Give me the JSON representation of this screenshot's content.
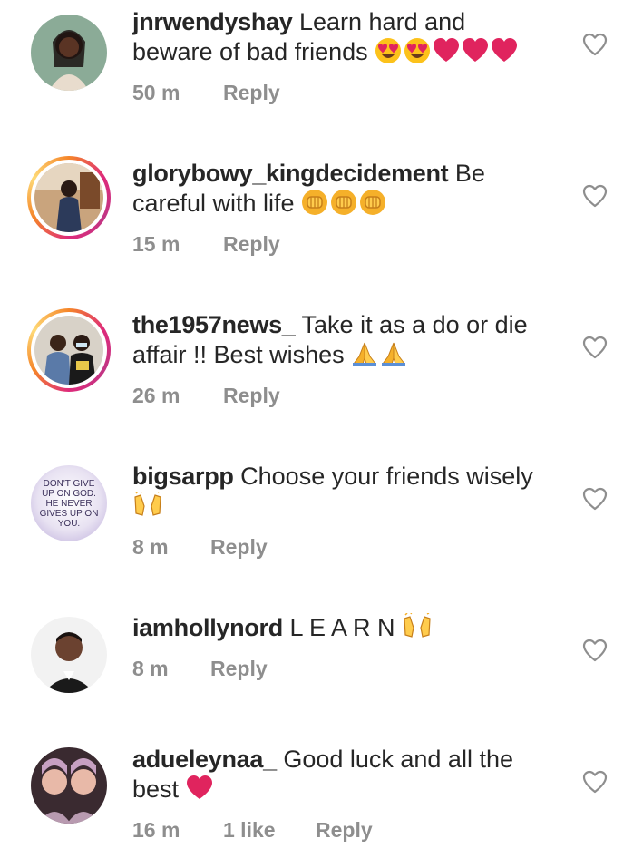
{
  "comments": [
    {
      "username": "jnrwendyshay",
      "text_line1": "Learn hard and",
      "text_line2": "beware of bad friends",
      "time": "50 m",
      "reply": "Reply",
      "emojis": [
        "heart-eyes",
        "heart-eyes",
        "red-heart",
        "red-heart",
        "red-heart"
      ]
    },
    {
      "username": "glorybowy_kingdecidement",
      "text_line1": "Be",
      "text_line2": "careful with life",
      "time": "15 m",
      "reply": "Reply",
      "emojis": [
        "raised-fist",
        "raised-fist",
        "raised-fist"
      ]
    },
    {
      "username": "the1957news_",
      "text_line1": "Take it as a do or die",
      "text_line2": "affair !! Best wishes",
      "time": "26 m",
      "reply": "Reply",
      "emojis": [
        "folded-hands",
        "folded-hands"
      ]
    },
    {
      "username": "bigsarpp",
      "text_line1": "Choose your friends wisely",
      "text_line2": "",
      "time": "8 m",
      "reply": "Reply",
      "avatar_text": "DON'T GIVE UP ON GOD. HE NEVER GIVES UP ON YOU.",
      "emojis": [
        "raised-hands"
      ]
    },
    {
      "username": "iamhollynord",
      "text_line1": "L E A R N",
      "text_line2": "",
      "time": "8 m",
      "reply": "Reply",
      "emojis": [
        "raised-hands"
      ]
    },
    {
      "username": "adueleynaa_",
      "text_line1": "Good luck and all the",
      "text_line2": "best",
      "time": "16 m",
      "likes": "1 like",
      "reply": "Reply",
      "emojis": [
        "red-heart"
      ]
    }
  ],
  "colors": {
    "text": "#262626",
    "meta": "#8e8e8e",
    "story_ring_start": "#f58529",
    "story_ring_end": "#dd2a7b",
    "heart_red": "#e0245e"
  },
  "icons": {
    "like": "heart-outline-icon"
  }
}
